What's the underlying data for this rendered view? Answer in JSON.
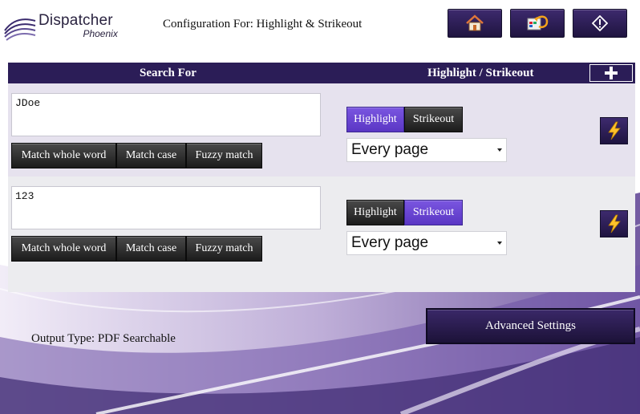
{
  "app": {
    "name": "Dispatcher",
    "subname": "Phoenix"
  },
  "header": {
    "title": "Configuration For: Highlight & Strikeout",
    "buttons": [
      {
        "icon": "home-icon"
      },
      {
        "icon": "undo-settings-icon"
      },
      {
        "icon": "diamond-info-icon"
      }
    ]
  },
  "table": {
    "col_search": "Search For",
    "col_mode": "Highlight / Strikeout",
    "add_icon": "plus-icon",
    "rows": [
      {
        "search_value": "JDoe",
        "options": [
          "Match whole word",
          "Match case",
          "Fuzzy match"
        ],
        "modes": [
          "Highlight",
          "Strikeout"
        ],
        "active_mode": "Highlight",
        "pages": "Every page"
      },
      {
        "search_value": "123",
        "options": [
          "Match whole word",
          "Match case",
          "Fuzzy match"
        ],
        "modes": [
          "Highlight",
          "Strikeout"
        ],
        "active_mode": "Strikeout",
        "pages": "Every page"
      }
    ]
  },
  "footer": {
    "output_type": "Output Type: PDF Searchable",
    "advanced": "Advanced Settings"
  },
  "colors": {
    "header_bar": "#2b1d57",
    "active_mode": "#6a46d4",
    "bolt": "#ffc22b"
  }
}
